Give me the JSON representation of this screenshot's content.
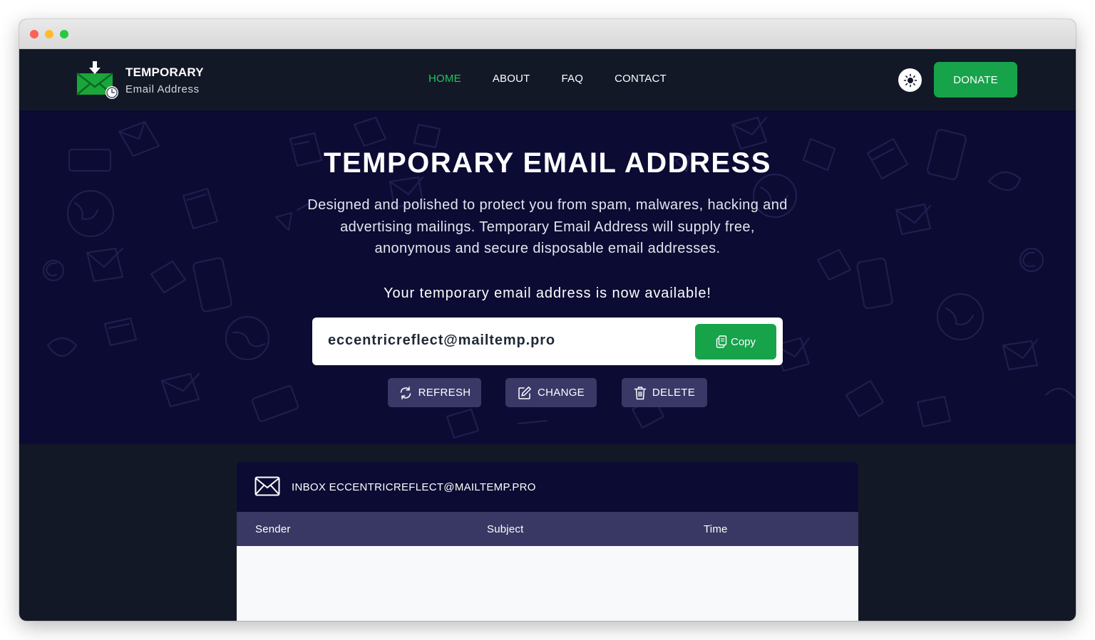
{
  "brand": {
    "title": "TEMPORARY",
    "subtitle": "Email Address"
  },
  "nav": {
    "items": [
      {
        "label": "HOME",
        "active": true
      },
      {
        "label": "ABOUT",
        "active": false
      },
      {
        "label": "FAQ",
        "active": false
      },
      {
        "label": "CONTACT",
        "active": false
      }
    ],
    "donate_label": "DONATE"
  },
  "hero": {
    "title": "TEMPORARY EMAIL ADDRESS",
    "description": "Designed and polished to protect you from spam, malwares, hacking and advertising mailings. Temporary Email Address will supply free, anonymous and secure disposable email addresses.",
    "status": "Your temporary email address is now available!",
    "email": "eccentricreflect@mailtemp.pro",
    "copy_label": "Copy",
    "actions": {
      "refresh": "REFRESH",
      "change": "CHANGE",
      "delete": "DELETE"
    }
  },
  "inbox": {
    "title": "INBOX ECCENTRICREFLECT@MAILTEMP.PRO",
    "columns": [
      "Sender",
      "Subject",
      "Time"
    ],
    "rows": []
  },
  "colors": {
    "accent": "#16a34a",
    "nav_active": "#22c55e",
    "navbar_bg": "#131826",
    "hero_bg": "#0c0b33",
    "action_button_bg": "#3a3866"
  },
  "icons": [
    "mail-download-logo-icon",
    "clock-icon",
    "sun-icon",
    "copy-icon",
    "refresh-icon",
    "edit-icon",
    "trash-icon",
    "envelope-icon"
  ]
}
